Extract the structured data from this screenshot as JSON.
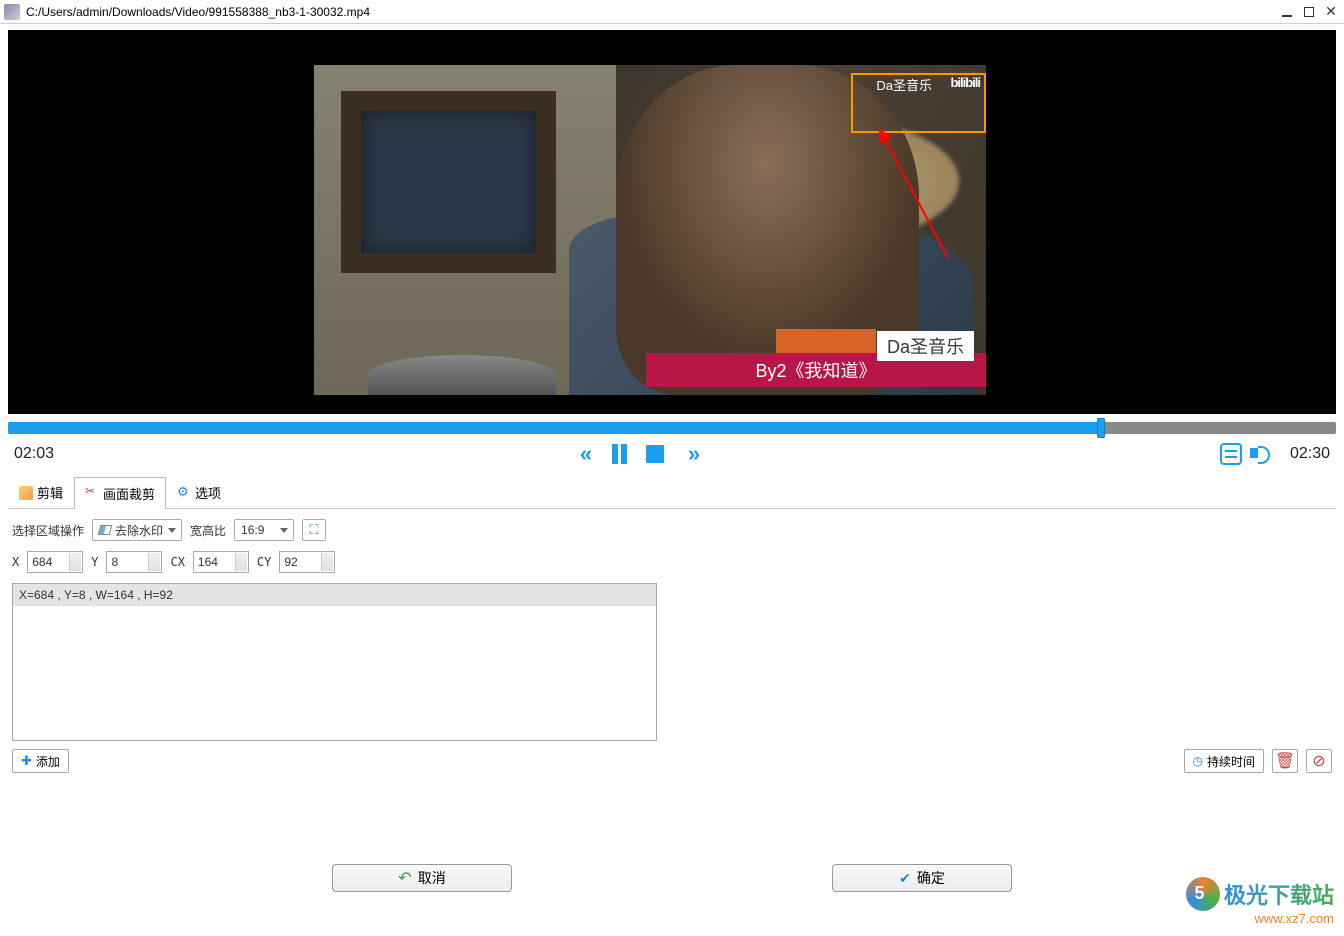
{
  "window": {
    "title": "C:/Users/admin/Downloads/Video/991558388_nb3-1-30032.mp4"
  },
  "video": {
    "watermark_text": "Da圣音乐",
    "watermark_brand": "bilibili",
    "caption_white": "Da圣音乐",
    "caption_red": "By2《我知道》"
  },
  "playback": {
    "time_current": "02:03",
    "time_total": "02:30"
  },
  "tabs": {
    "edit": "剪辑",
    "crop": "画面裁剪",
    "options": "选项"
  },
  "crop": {
    "area_label": "选择区域操作",
    "area_value": "去除水印",
    "ratio_label": "宽高比",
    "ratio_value": "16:9",
    "x_label": "X",
    "x_value": "684",
    "y_label": "Y",
    "y_value": "8",
    "cx_label": "CX",
    "cx_value": "164",
    "cy_label": "CY",
    "cy_value": "92",
    "list_item": "X=684 , Y=8 , W=164 , H=92",
    "add_btn": "添加",
    "duration_btn": "持续时间"
  },
  "buttons": {
    "cancel": "取消",
    "ok": "确定"
  },
  "site": {
    "name": "极光下载站",
    "url": "www.xz7.com"
  }
}
